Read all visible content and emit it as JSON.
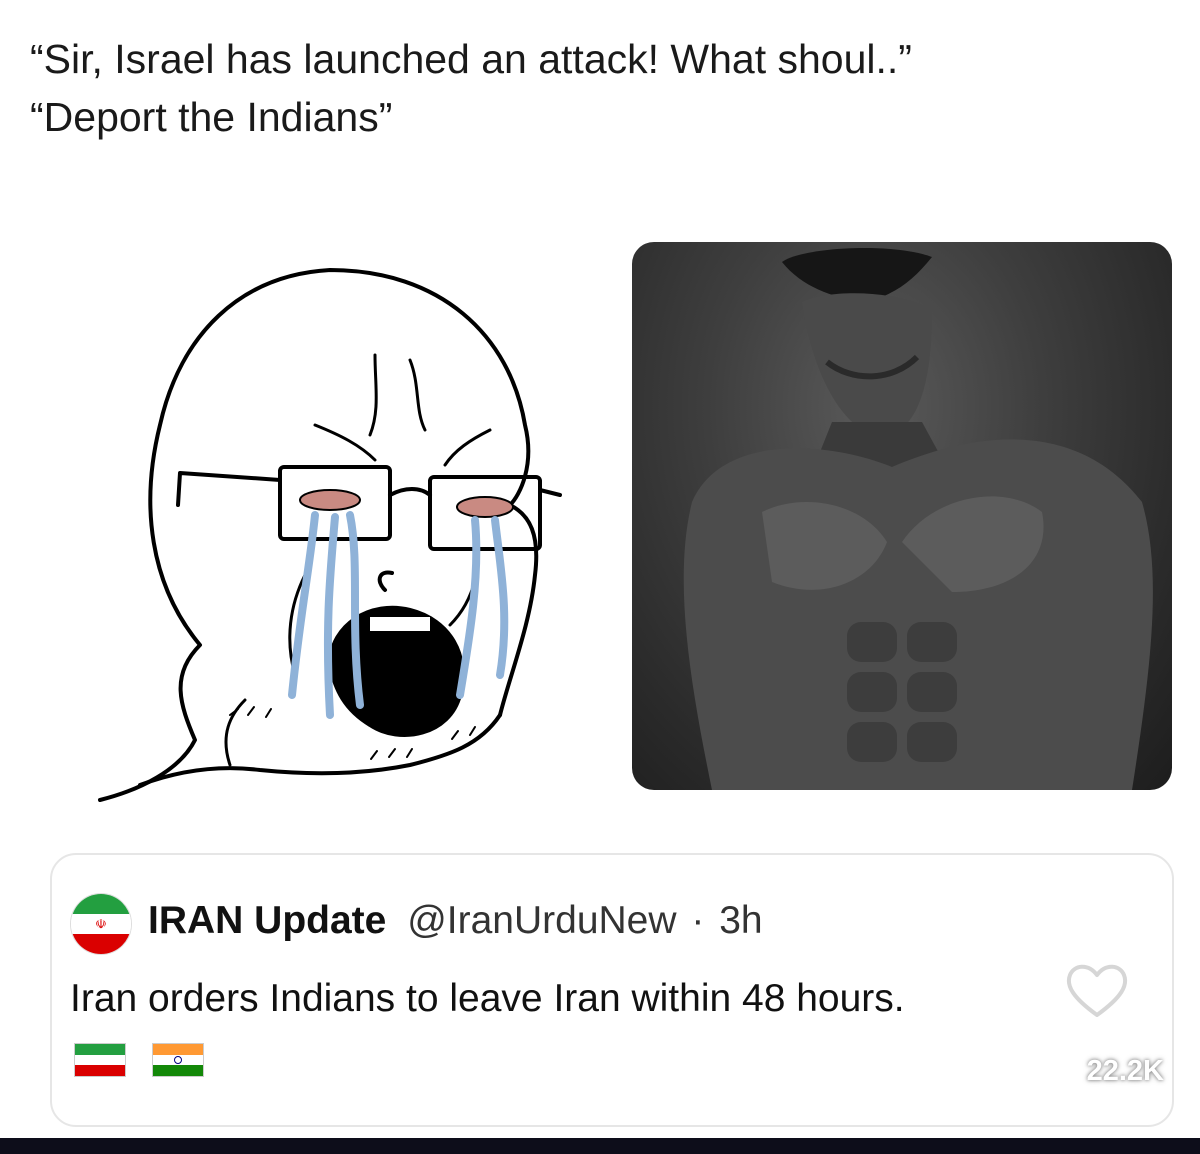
{
  "caption": {
    "line1": "“Sir, Israel has launched an attack! What shoul..”",
    "line2": "“Deport the Indians”"
  },
  "images": {
    "left": "crying-wojak-with-glasses",
    "right": "grayscale-muscular-chad"
  },
  "tweet": {
    "avatar_icon": "iran-flag-icon",
    "display_name": "IRAN Update",
    "handle": "@IranUrduNew",
    "separator": "·",
    "time": "3h",
    "text": "Iran orders Indians to leave Iran within 48 hours.",
    "flags": [
      "iran-flag-icon",
      "india-flag-icon"
    ],
    "like_count": "22.2K"
  },
  "colors": {
    "iran_green": "#239f40",
    "iran_red": "#da0000",
    "india_saffron": "#ff9933",
    "india_green": "#138808",
    "india_chakra": "#000080"
  }
}
